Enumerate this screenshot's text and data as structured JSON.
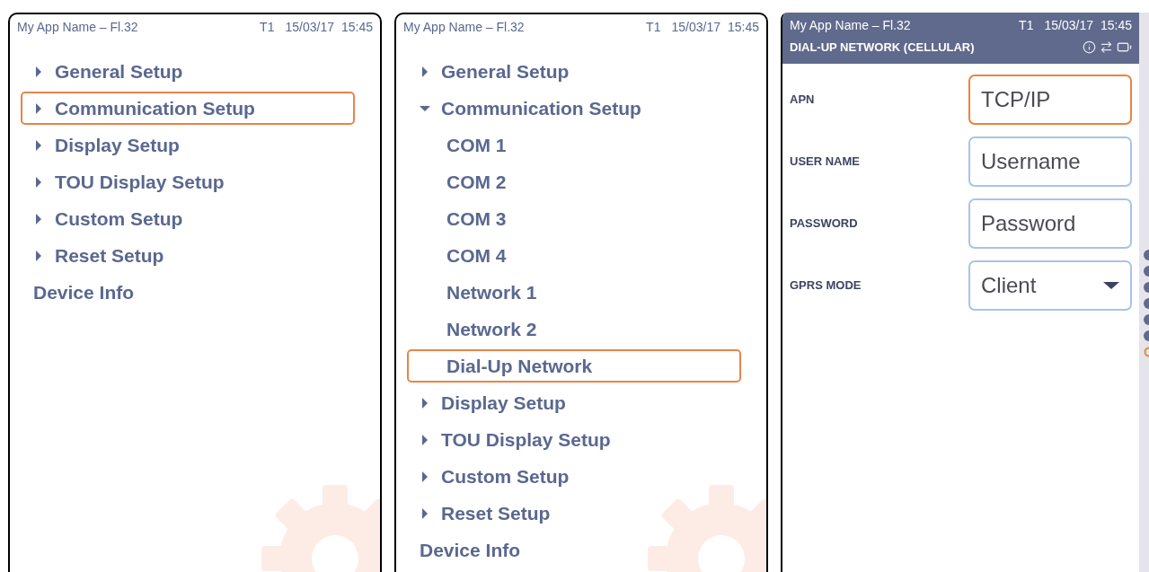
{
  "screens": [
    {
      "kind": "menu",
      "header": {
        "app_name": "My App Name – Fl.32",
        "terminal": "T1",
        "date": "15/03/17",
        "time": "15:45"
      },
      "menu": [
        {
          "kind": "group",
          "label": "General Setup",
          "expanded": false,
          "selected": false
        },
        {
          "kind": "group",
          "label": "Communication Setup",
          "expanded": false,
          "selected": true
        },
        {
          "kind": "group",
          "label": "Display Setup",
          "expanded": false,
          "selected": false
        },
        {
          "kind": "group",
          "label": "TOU Display Setup",
          "expanded": false,
          "selected": false
        },
        {
          "kind": "group",
          "label": "Custom Setup",
          "expanded": false,
          "selected": false
        },
        {
          "kind": "group",
          "label": "Reset Setup",
          "expanded": false,
          "selected": false
        },
        {
          "kind": "link",
          "label": "Device Info",
          "selected": false
        }
      ]
    },
    {
      "kind": "menu",
      "header": {
        "app_name": "My App Name – Fl.32",
        "terminal": "T1",
        "date": "15/03/17",
        "time": "15:45"
      },
      "menu": [
        {
          "kind": "group",
          "label": "General Setup",
          "expanded": false,
          "selected": false
        },
        {
          "kind": "group",
          "label": "Communication Setup",
          "expanded": true,
          "selected": false,
          "children": [
            {
              "label": "COM 1",
              "selected": false
            },
            {
              "label": "COM 2",
              "selected": false
            },
            {
              "label": "COM 3",
              "selected": false
            },
            {
              "label": "COM 4",
              "selected": false
            },
            {
              "label": "Network 1",
              "selected": false
            },
            {
              "label": "Network 2",
              "selected": false
            },
            {
              "label": "Dial-Up Network",
              "selected": true
            }
          ]
        },
        {
          "kind": "group",
          "label": "Display Setup",
          "expanded": false,
          "selected": false
        },
        {
          "kind": "group",
          "label": "TOU Display Setup",
          "expanded": false,
          "selected": false
        },
        {
          "kind": "group",
          "label": "Custom Setup",
          "expanded": false,
          "selected": false
        },
        {
          "kind": "group",
          "label": "Reset Setup",
          "expanded": false,
          "selected": false
        },
        {
          "kind": "link",
          "label": "Device Info",
          "selected": false
        }
      ]
    },
    {
      "kind": "form",
      "header": {
        "app_name": "My App Name – Fl.32",
        "terminal": "T1",
        "date": "15/03/17",
        "time": "15:45"
      },
      "title": "DIAL-UP NETWORK (CELLULAR)",
      "fields": [
        {
          "kind": "text",
          "label": "APN",
          "value": "TCP/IP",
          "focused": true
        },
        {
          "kind": "text",
          "label": "USER NAME",
          "value": "Username",
          "focused": false
        },
        {
          "kind": "text",
          "label": "PASSWORD",
          "value": "Password",
          "focused": false
        },
        {
          "kind": "select",
          "label": "GPRS MODE",
          "value": "Client",
          "focused": false
        }
      ]
    }
  ]
}
